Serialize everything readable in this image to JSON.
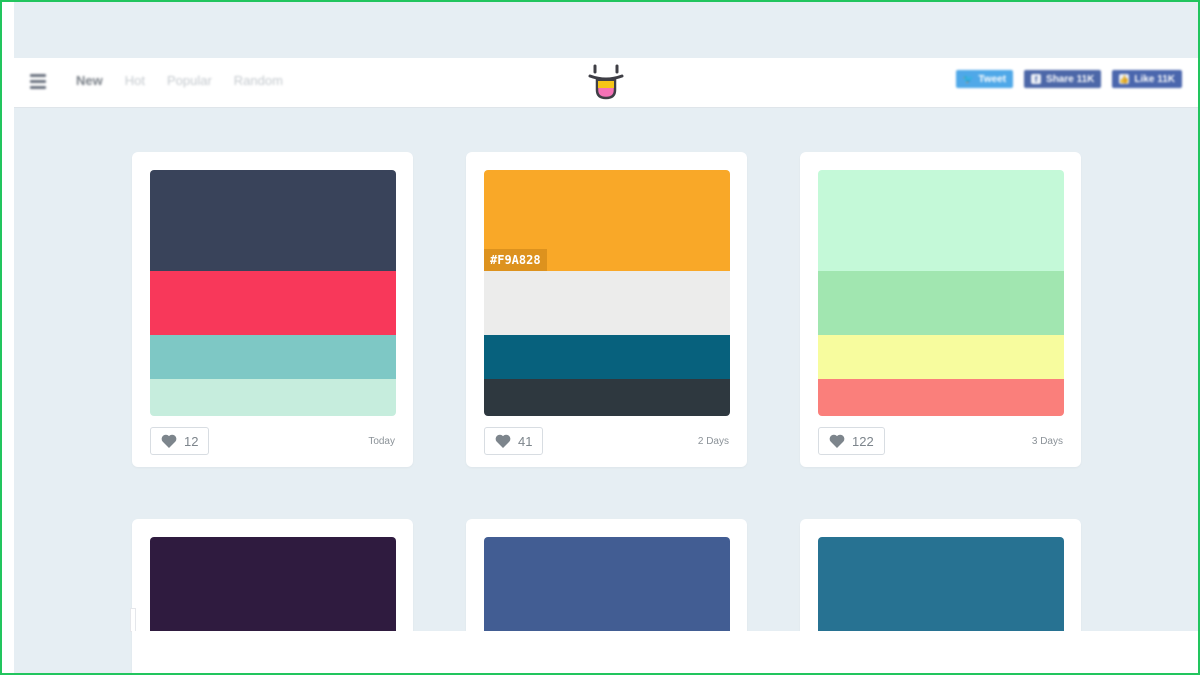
{
  "nav": {
    "menu_icon": "hamburger-icon",
    "items": [
      {
        "label": "New",
        "active": true
      },
      {
        "label": "Hot",
        "active": false
      },
      {
        "label": "Popular",
        "active": false
      },
      {
        "label": "Random",
        "active": false
      }
    ]
  },
  "logo": {
    "icon": "smiley-logo-icon",
    "colors": [
      "#3f3f46",
      "#f5c518",
      "#f472b6"
    ]
  },
  "social": {
    "tweet_label": "Tweet",
    "share_label": "Share 11K",
    "like_label": "Like 11K"
  },
  "cards": [
    {
      "colors": [
        "#39435a",
        "#f8385a",
        "#7ec8c5",
        "#c6eddd"
      ],
      "likes": "12",
      "date": "Today"
    },
    {
      "colors": [
        "#f9a828",
        "#ececeb",
        "#07617d",
        "#2e383f"
      ],
      "likes": "41",
      "date": "2 Days",
      "hex_label": "#F9A828"
    },
    {
      "colors": [
        "#c4f9d8",
        "#a1e6b0",
        "#f7fc9e",
        "#fa7f7b"
      ],
      "likes": "122",
      "date": "3 Days"
    },
    {
      "colors": [
        "#2f1b3f"
      ]
    },
    {
      "colors": [
        "#425d93"
      ]
    },
    {
      "colors": [
        "#277292"
      ]
    }
  ]
}
